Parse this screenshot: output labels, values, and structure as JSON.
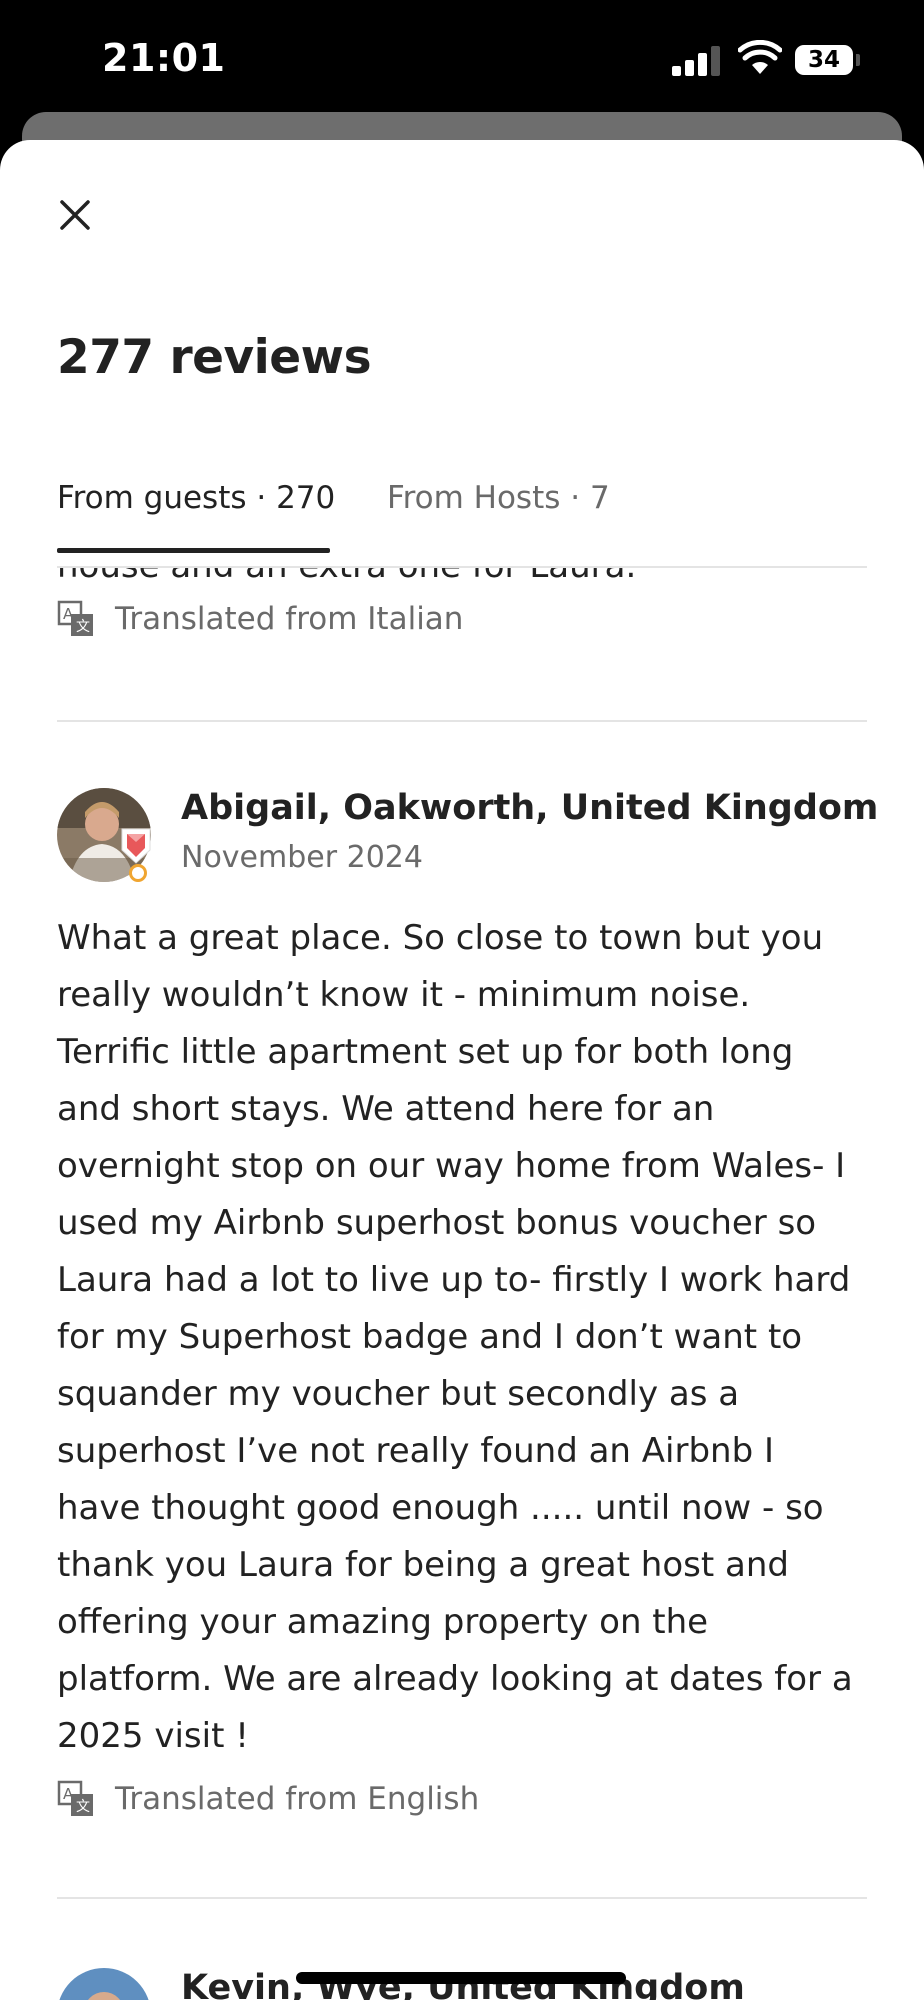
{
  "status_bar": {
    "time": "21:01",
    "battery": "34"
  },
  "modal": {
    "title": "277 reviews",
    "tabs": [
      {
        "label": "From guests · 270",
        "active": true
      },
      {
        "label": "From Hosts · 7",
        "active": false
      }
    ],
    "previous_review": {
      "clipped_text": "house and an extra one for Laura.",
      "translated_note": "Translated from Italian"
    },
    "reviews": [
      {
        "name": "Abigail, Oakworth, United Kingdom",
        "date": "November 2024",
        "text": "What a great place. So close to town but you\nreally wouldn’t know it - minimum noise.\nTerrific little apartment set up for both long\nand short stays.  We attend here for an\novernight stop on our way home from Wales- I\nused my Airbnb superhost bonus voucher so\nLaura had a lot to live up to- firstly I work hard\nfor my Superhost badge and I don’t want to\nsquander my voucher but secondly as a\nsuperhost I’ve not really found an Airbnb I\nhave thought good enough ..... until now - so\nthank you Laura for being a great host and\noffering your amazing property on the\nplatform. We are already looking at dates for a\n2025 visit !",
        "translated_note": "Translated from English",
        "superhost_badge": true
      },
      {
        "name": "Kevin, Wye, United Kingdom"
      }
    ]
  },
  "icons": {
    "close": "close-icon",
    "translate": "translate-icon",
    "superhost_badge": "superhost-badge-icon"
  },
  "colors": {
    "text_primary": "#222222",
    "text_secondary": "#6a6a6a",
    "divider": "#e4e4e4",
    "badge": "#e8585a"
  }
}
